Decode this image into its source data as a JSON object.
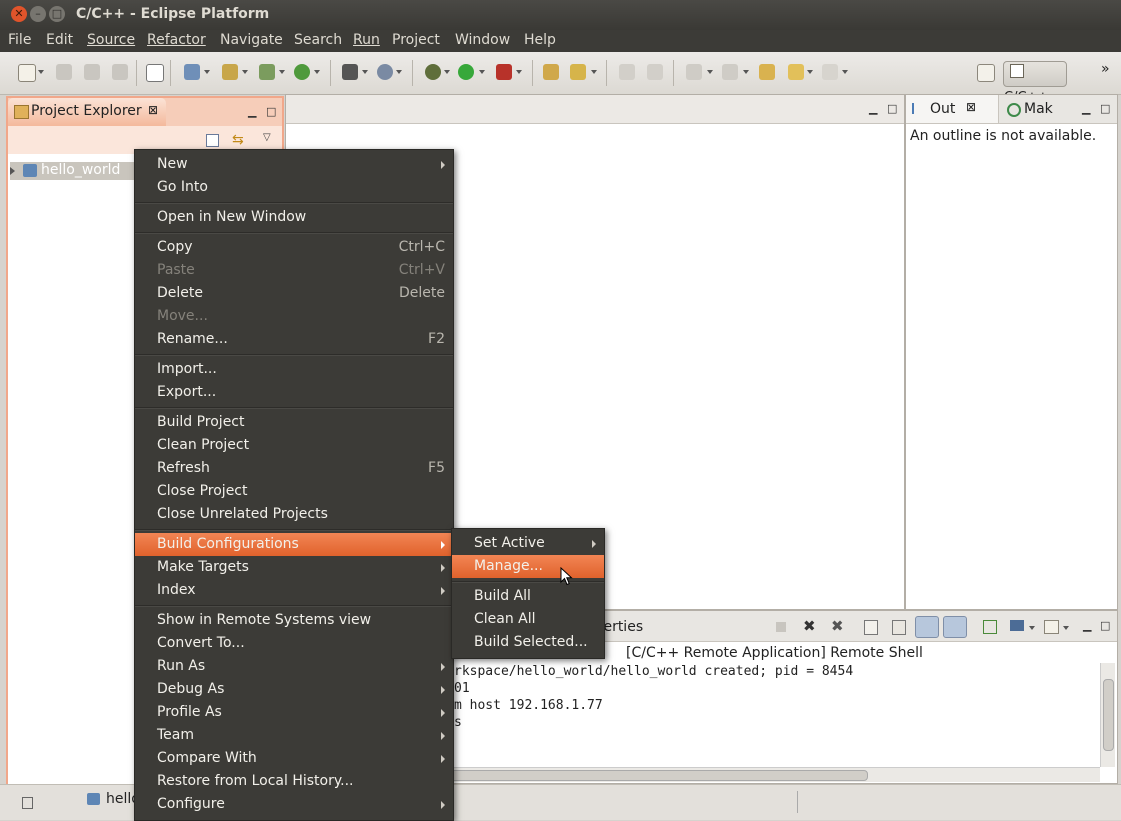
{
  "window": {
    "title": "C/C++ - Eclipse Platform",
    "controls": [
      "close",
      "minimize",
      "maximize"
    ]
  },
  "menubar": [
    "File",
    "Edit",
    "Source",
    "Refactor",
    "Navigate",
    "Search",
    "Run",
    "Project",
    "Window",
    "Help"
  ],
  "toolbar": {
    "perspective_label": "C/C++",
    "overflow": "»"
  },
  "project_explorer": {
    "tab_label": "Project Explorer",
    "tree": [
      {
        "label": "hello_world",
        "icon": "c-project-icon"
      }
    ]
  },
  "outline": {
    "tabs": [
      "Out",
      "Mak"
    ],
    "message": "An outline is not available."
  },
  "console": {
    "tab_partial": "operties",
    "header_partial": "[C/C++ Remote Application] Remote Shell",
    "lines": [
      "rkspace/hello_world/hello_world created; pid = 8454",
      "01",
      "m host 192.168.1.77",
      "s"
    ]
  },
  "statusbar": {
    "item_partial": "hello"
  },
  "context_menu": {
    "items": [
      {
        "label": "New",
        "submenu": true
      },
      {
        "label": "Go Into"
      },
      {
        "sep": true
      },
      {
        "label": "Open in New Window"
      },
      {
        "sep": true
      },
      {
        "label": "Copy",
        "accel": "Ctrl+C"
      },
      {
        "label": "Paste",
        "accel": "Ctrl+V",
        "disabled": true
      },
      {
        "label": "Delete",
        "accel": "Delete"
      },
      {
        "label": "Move...",
        "disabled": true
      },
      {
        "label": "Rename...",
        "accel": "F2"
      },
      {
        "sep": true
      },
      {
        "label": "Import..."
      },
      {
        "label": "Export..."
      },
      {
        "sep": true
      },
      {
        "label": "Build Project"
      },
      {
        "label": "Clean Project"
      },
      {
        "label": "Refresh",
        "accel": "F5"
      },
      {
        "label": "Close Project"
      },
      {
        "label": "Close Unrelated Projects"
      },
      {
        "sep": true
      },
      {
        "label": "Build Configurations",
        "submenu": true,
        "active": true
      },
      {
        "label": "Make Targets",
        "submenu": true
      },
      {
        "label": "Index",
        "submenu": true
      },
      {
        "sep": true
      },
      {
        "label": "Show in Remote Systems view"
      },
      {
        "label": "Convert To..."
      },
      {
        "label": "Run As",
        "submenu": true
      },
      {
        "label": "Debug As",
        "submenu": true
      },
      {
        "label": "Profile As",
        "submenu": true
      },
      {
        "label": "Team",
        "submenu": true
      },
      {
        "label": "Compare With",
        "submenu": true
      },
      {
        "label": "Restore from Local History..."
      },
      {
        "label": "Configure",
        "submenu": true
      }
    ]
  },
  "build_config_submenu": {
    "items": [
      {
        "label": "Set Active",
        "submenu": true
      },
      {
        "label": "Manage...",
        "active": true
      },
      {
        "sep": true
      },
      {
        "label": "Build All"
      },
      {
        "label": "Clean All"
      },
      {
        "label": "Build Selected..."
      }
    ]
  },
  "colors": {
    "menu_bg": "#3c3b37",
    "highlight": "#e8713d",
    "active_panel_border": "#f1a78a"
  }
}
